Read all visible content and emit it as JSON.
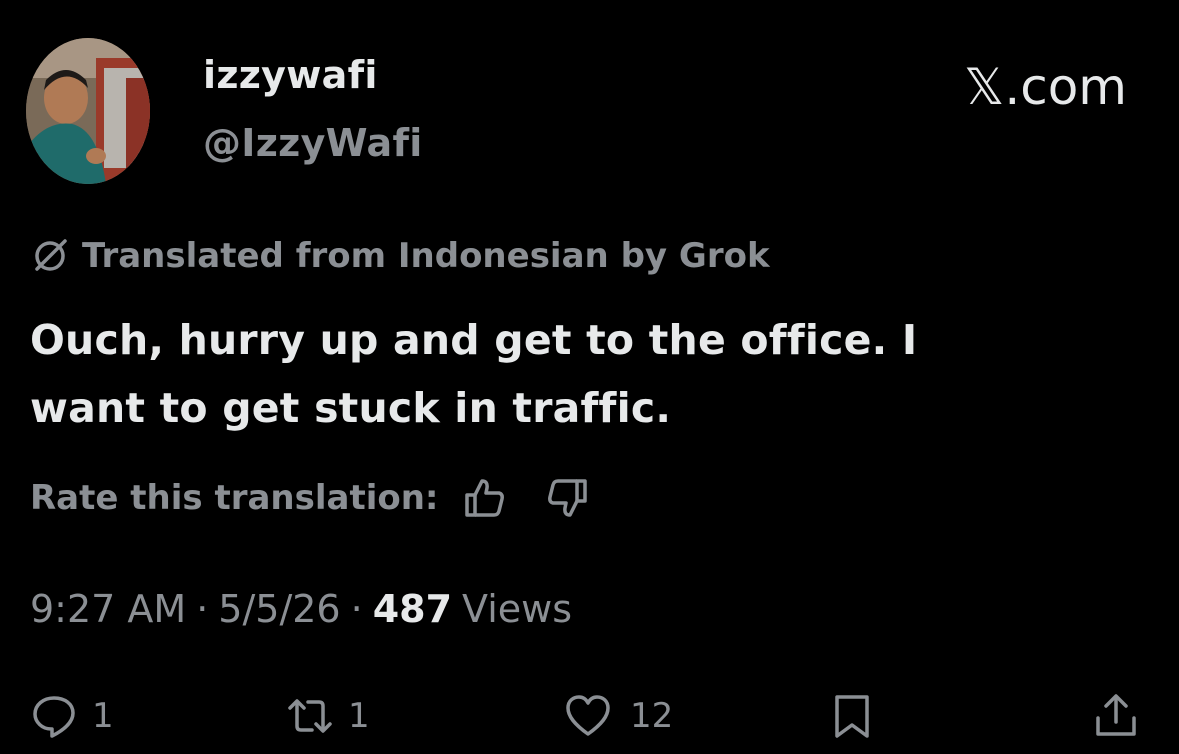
{
  "brand": {
    "label": "𝕏.com"
  },
  "author": {
    "display_name": "izzywafi",
    "handle": "@IzzyWafi"
  },
  "translation": {
    "notice": "Translated from Indonesian by Grok",
    "rate_label": "Rate this translation:"
  },
  "tweet": {
    "text_line1": "Ouch, hurry up and get to the office. I",
    "text_line2": "want to get stuck in traffic."
  },
  "meta": {
    "time": "9:27 AM",
    "date": "5/5/26",
    "separator": "·",
    "views_count": "487",
    "views_label": "Views"
  },
  "actions": {
    "replies": "1",
    "reposts": "1",
    "likes": "12"
  },
  "colors": {
    "background": "#000000",
    "primary_text": "#e7e9ea",
    "secondary_text": "#8b8f94"
  }
}
